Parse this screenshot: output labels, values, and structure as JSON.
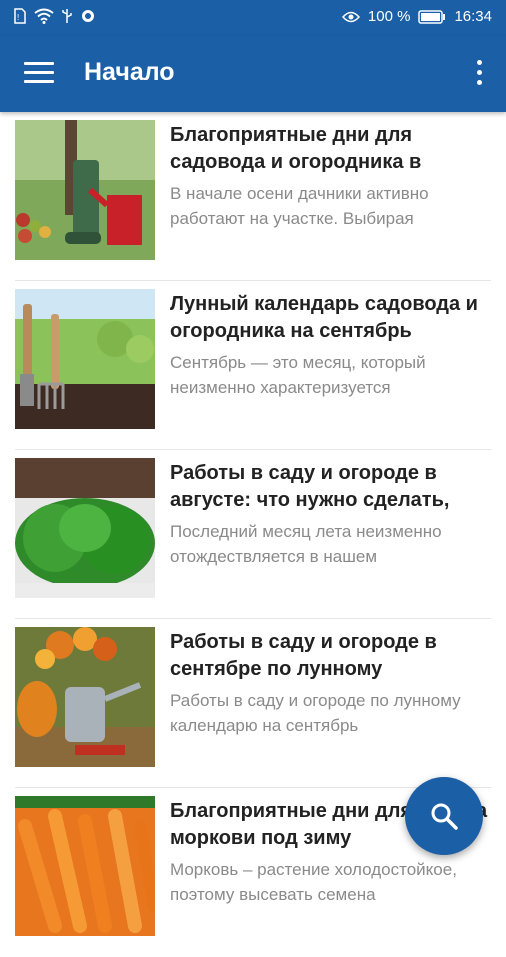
{
  "status_bar": {
    "battery": "100 %",
    "time": "16:34"
  },
  "app_bar": {
    "title": "Начало"
  },
  "articles": [
    {
      "title": "Благоприятные дни для садовода и огородника в",
      "excerpt": "В начале осени дачники активно работают на участке. Выбирая",
      "image": "boots-and-watering-can"
    },
    {
      "title": "Лунный календарь садовода и огородника на сентябрь",
      "excerpt": "Сентябрь — это месяц, который неизменно характеризуется",
      "image": "garden-tools-in-soil"
    },
    {
      "title": "Работы в саду и огороде в августе: что нужно сделать,",
      "excerpt": "Последний месяц лета неизменно отождествляется в нашем",
      "image": "dill-greens"
    },
    {
      "title": "Работы в саду и огороде в сентябре по лунному",
      "excerpt": "Работы в саду и огороде по лунному календарю на сентябрь",
      "image": "pumpkin-and-watering-can"
    },
    {
      "title": "Благоприятные дни для посева моркови под зиму",
      "excerpt": "Морковь – растение холодостойкое, поэтому высевать семена",
      "image": "carrots"
    }
  ],
  "fab": {
    "icon": "search-icon"
  },
  "colors": {
    "primary": "#1b5fa6",
    "title_text": "#222222",
    "excerpt_text": "#8a8a8a"
  }
}
